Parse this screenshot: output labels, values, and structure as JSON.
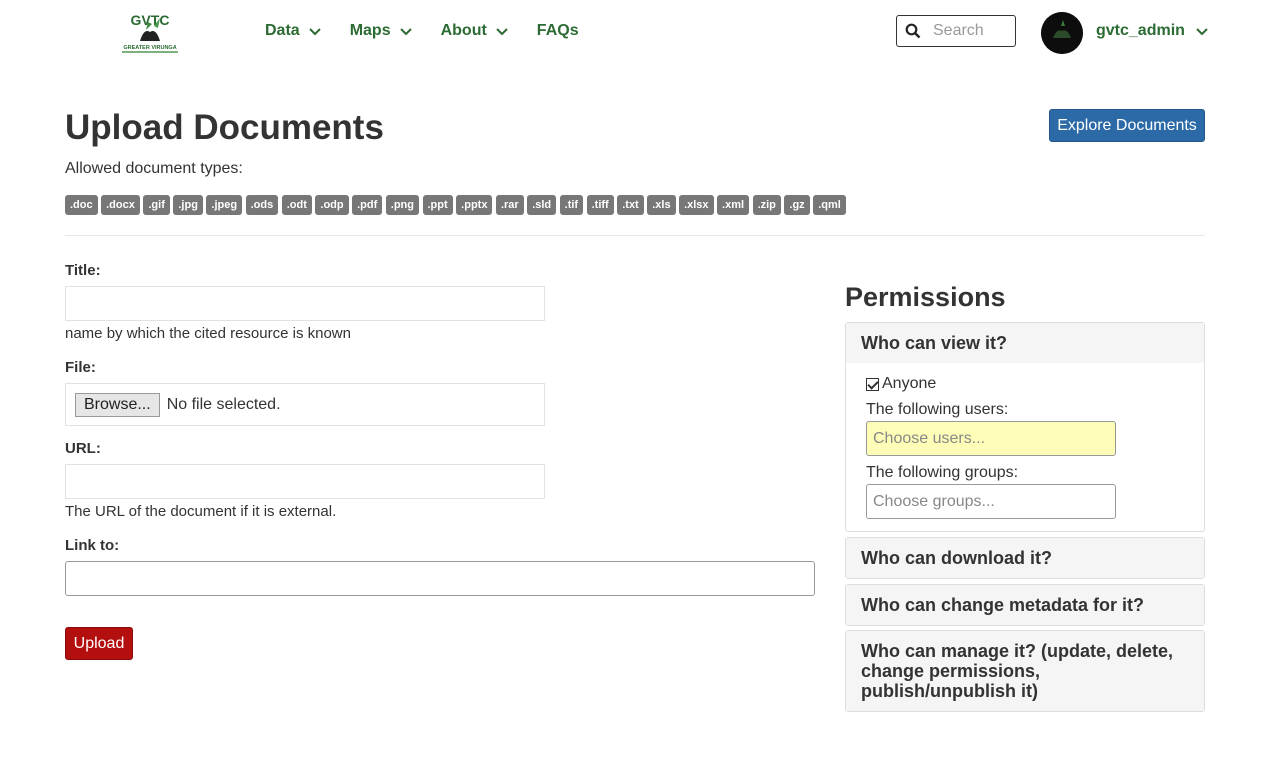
{
  "header": {
    "logo_text": "GVTC",
    "logo_subtext": "GREATER VIRUNGA",
    "nav": [
      {
        "label": "Data",
        "has_dropdown": true
      },
      {
        "label": "Maps",
        "has_dropdown": true
      },
      {
        "label": "About",
        "has_dropdown": true
      },
      {
        "label": "FAQs",
        "has_dropdown": false
      }
    ],
    "search_placeholder": "Search",
    "username": "gvtc_admin"
  },
  "page": {
    "title": "Upload Documents",
    "explore_button": "Explore Documents",
    "allowed_label": "Allowed document types:",
    "types": [
      ".doc",
      ".docx",
      ".gif",
      ".jpg",
      ".jpeg",
      ".ods",
      ".odt",
      ".odp",
      ".pdf",
      ".png",
      ".ppt",
      ".pptx",
      ".rar",
      ".sld",
      ".tif",
      ".tiff",
      ".txt",
      ".xls",
      ".xlsx",
      ".xml",
      ".zip",
      ".gz",
      ".qml"
    ]
  },
  "form": {
    "title_label": "Title:",
    "title_value": "",
    "title_help": "name by which the cited resource is known",
    "file_label": "File:",
    "browse_label": "Browse...",
    "file_status": "No file selected.",
    "url_label": "URL:",
    "url_value": "",
    "url_help": "The URL of the document if it is external.",
    "link_label": "Link to:",
    "link_value": "",
    "upload_button": "Upload"
  },
  "permissions": {
    "title": "Permissions",
    "view_heading": "Who can view it?",
    "anyone_label": "Anyone",
    "anyone_checked": true,
    "users_label": "The following users:",
    "users_placeholder": "Choose users...",
    "groups_label": "The following groups:",
    "groups_placeholder": "Choose groups...",
    "download_heading": "Who can download it?",
    "metadata_heading": "Who can change metadata for it?",
    "manage_heading": "Who can manage it? (update, delete, change permissions, publish/unpublish it)"
  },
  "colors": {
    "brand_green": "#2c6b33",
    "explore_blue": "#2b6aa6",
    "upload_red": "#b30f0f",
    "badge_grey": "#777777",
    "highlight_yellow": "#fdfdb8"
  }
}
